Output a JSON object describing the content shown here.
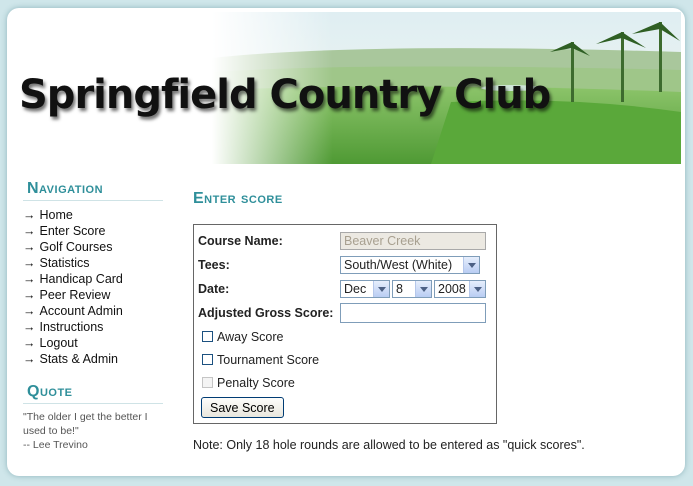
{
  "header": {
    "site_title": "Springfield Country Club"
  },
  "sidebar": {
    "nav_heading": "Navigation",
    "nav_items": [
      {
        "label": "Home"
      },
      {
        "label": "Enter Score"
      },
      {
        "label": "Golf Courses"
      },
      {
        "label": "Statistics"
      },
      {
        "label": "Handicap Card"
      },
      {
        "label": "Peer Review"
      },
      {
        "label": "Account Admin"
      },
      {
        "label": "Instructions"
      },
      {
        "label": "Logout"
      },
      {
        "label": "Stats & Admin"
      }
    ],
    "arrow_glyph": "→",
    "quote_heading": "Quote",
    "quote_line1": "\"The older I get the better I used to be!\"",
    "quote_author": "-- Lee Trevino"
  },
  "main": {
    "heading": "Enter score",
    "form": {
      "course_label": "Course Name:",
      "course_value": "Beaver Creek",
      "tees_label": "Tees:",
      "tees_value": "South/West (White)",
      "date_label": "Date:",
      "date_month": "Dec",
      "date_day": "8",
      "date_year": "2008",
      "ags_label": "Adjusted Gross Score:",
      "ags_value": "",
      "away_label": "Away Score",
      "away_checked": false,
      "tournament_label": "Tournament Score",
      "tournament_checked": false,
      "penalty_label": "Penalty Score",
      "penalty_checked": false,
      "save_label": "Save Score"
    },
    "note": "Note: Only 18 hole rounds are allowed to be entered as \"quick scores\"."
  }
}
